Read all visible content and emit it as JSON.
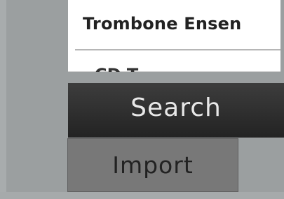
{
  "results": {
    "items": [
      {
        "title": "Trombone Ensen"
      },
      {
        "title": "CD T"
      }
    ]
  },
  "actions": {
    "search_label": "Search",
    "import_label": "Import"
  }
}
